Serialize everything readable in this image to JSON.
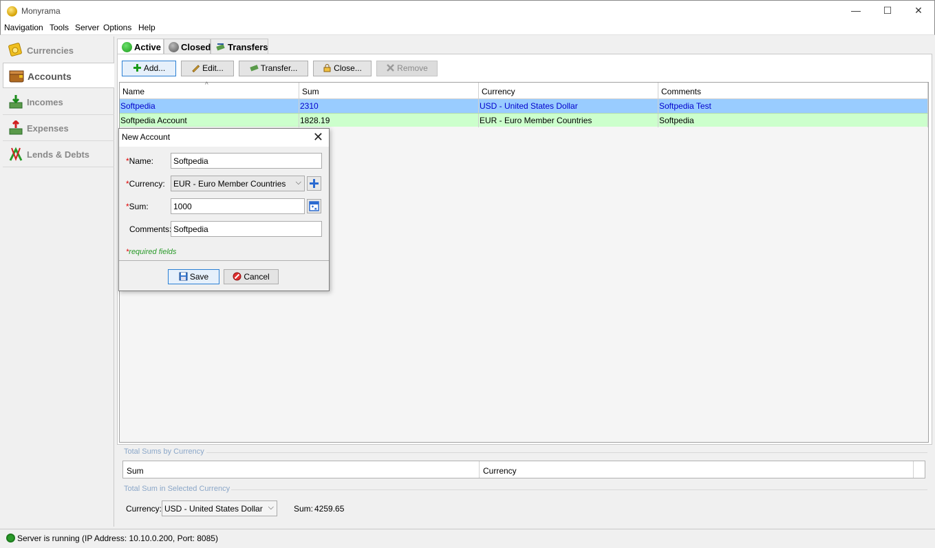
{
  "window": {
    "title": "Monyrama",
    "minimize": "—",
    "maximize": "☐",
    "close": "✕"
  },
  "menu": [
    "Navigation",
    "Tools",
    "Server",
    "Options",
    "Help"
  ],
  "sidebar": {
    "items": [
      {
        "label": "Currencies",
        "icon": "currencies-icon"
      },
      {
        "label": "Accounts",
        "icon": "accounts-icon",
        "active": true
      },
      {
        "label": "Incomes",
        "icon": "incomes-icon"
      },
      {
        "label": "Expenses",
        "icon": "expenses-icon"
      },
      {
        "label": "Lends & Debts",
        "icon": "lends-debts-icon"
      }
    ]
  },
  "tabs": [
    {
      "label": "Active",
      "active": true
    },
    {
      "label": "Closed"
    },
    {
      "label": "Transfers"
    }
  ],
  "toolbar": {
    "add": "Add...",
    "edit": "Edit...",
    "transfer": "Transfer...",
    "close": "Close...",
    "remove": "Remove"
  },
  "table": {
    "columns": [
      "Name",
      "Sum",
      "Currency",
      "Comments"
    ],
    "rows": [
      {
        "name": "Softpedia",
        "sum": "2310",
        "currency": "USD - United States Dollar",
        "comments": "Softpedia Test",
        "selected": true
      },
      {
        "name": "Softpedia Account",
        "sum": "1828.19",
        "currency": "EUR - Euro Member Countries",
        "comments": "Softpedia"
      }
    ]
  },
  "dialog": {
    "title": "New Account",
    "close": "✕",
    "required_mark": "*",
    "name_label": "Name:",
    "name_value": "Softpedia",
    "currency_label": "Currency:",
    "currency_value": "EUR - Euro Member Countries",
    "sum_label": "Sum:",
    "sum_value": "1000",
    "comments_label": "Comments:",
    "comments_value": "Softpedia",
    "required_note": "required fields",
    "save": "Save",
    "cancel": "Cancel"
  },
  "totals": {
    "by_currency_title": "Total Sums by Currency",
    "columns": [
      "Sum",
      "Currency"
    ],
    "selected_title": "Total Sum in Selected Currency",
    "currency_label": "Currency:",
    "currency_value": "USD - United States Dollar",
    "sum_label": "Sum:",
    "sum_value": "4259.65"
  },
  "status": {
    "text": "Server is running (IP Address: 10.10.0.200, Port: 8085)"
  },
  "colors": {
    "selected_row": "#99ccff",
    "alt_row": "#ccffcc",
    "accent": "#2a7fd4"
  }
}
